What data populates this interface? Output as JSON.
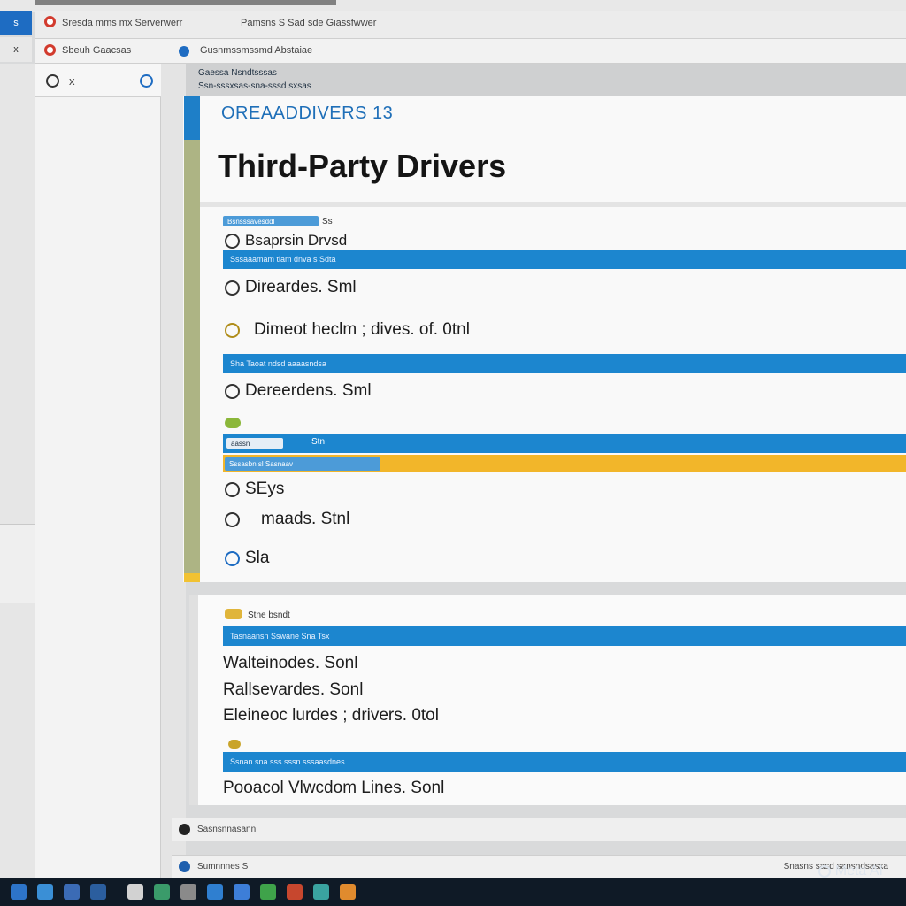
{
  "window": {
    "tab_title": "Sresda mms mx Serverwerr",
    "tab_secondary": "Pamsns S Sad sde Giassfwwer",
    "address_left": "Sbeuh Gaacsas",
    "address_right": "Gusnmssmssmd Abstaiae",
    "left_badge_top": "s",
    "left_badge_bottom": "x"
  },
  "sidebar": {
    "header_text": "x"
  },
  "breadcrumb": {
    "line1": "Gaessa Nsndtsssas",
    "line2": "Ssn-sssxsas-sna-sssd sxsas"
  },
  "main": {
    "app_name": "OREAADDIVERS 13",
    "page_title": "Third-Party Drivers"
  },
  "sections": [
    {
      "chip": "Bsnsssavesddl",
      "chip_suffix": "Ss",
      "header_label": "Bsaprsin Drvsd",
      "bar_text": "Sssaaamam tiam dnva s Sdta",
      "items": [
        {
          "label": "Direardes. Sml"
        },
        {
          "label": "Dimeot heclm ; dives. of. 0tnl"
        }
      ]
    },
    {
      "bar_text": "Sha Taoat ndsd aaaasndsa",
      "items": [
        {
          "label": "Dereerdens. Sml"
        }
      ]
    },
    {
      "chip": "aassn",
      "chip_suffix": "Stn",
      "chip2": "Sssasbn sl Sasnaav",
      "items": [
        {
          "label": "SEys"
        },
        {
          "label": "maads. Stnl"
        },
        {
          "label": "Sla"
        }
      ]
    }
  ],
  "lower_sections": [
    {
      "tag": "Stne bsndt",
      "bar_text": "Tasnaansn Sswane Sna Tsx",
      "items": [
        {
          "label": "Walteinodes. Sonl"
        },
        {
          "label": "Rallsevardes. Sonl"
        },
        {
          "label": "Eleineoc lurdes ; drivers. 0tol"
        }
      ]
    },
    {
      "bar_text": "Ssnan sna sss sssn sssaasdnes",
      "items": [
        {
          "label": "Pooacol Vlwcdom Lines. Sonl"
        }
      ]
    }
  ],
  "status": {
    "line1": "Sasnsnnasann",
    "line2": "Sumnnnes S",
    "line2_right": "Snasns sasd sansndsasxa"
  },
  "watermark": "Meta AI",
  "colors": {
    "accent_blue": "#1c86cf",
    "accent_yellow": "#f2b62a",
    "title_blue": "#1f6fb8"
  }
}
